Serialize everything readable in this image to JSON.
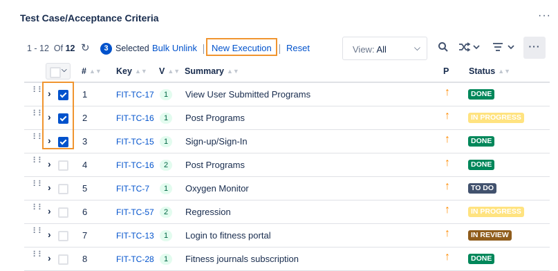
{
  "panel": {
    "title": "Test Case/Acceptance Criteria",
    "more_label": "···"
  },
  "toolbar": {
    "range": "1 - 12",
    "of_label": "Of",
    "total": "12",
    "refresh_icon": "refresh-icon",
    "selected_count": "3",
    "selected_label": "Selected",
    "bulk_unlink": "Bulk Unlink",
    "new_execution": "New Execution",
    "reset": "Reset",
    "view_label": "View:",
    "view_value": "All",
    "more_label": "···"
  },
  "columns": {
    "num": "#",
    "key": "Key",
    "version": "V",
    "summary": "Summary",
    "priority": "P",
    "status": "Status"
  },
  "colors": {
    "accent": "#0052cc",
    "highlight": "#f0942e",
    "done": "#00875a",
    "in_progress": "#ffe380",
    "todo": "#42526e",
    "in_review": "#8f5c1c",
    "priority": "#ff8b00"
  },
  "rows": [
    {
      "num": "1",
      "key": "FIT-TC-17",
      "version": "1",
      "summary": "View User Submitted Programs",
      "status": "DONE",
      "status_type": "done",
      "checked": true
    },
    {
      "num": "2",
      "key": "FIT-TC-16",
      "version": "1",
      "summary": "Post Programs",
      "status": "IN PROGRESS",
      "status_type": "progress",
      "checked": true
    },
    {
      "num": "3",
      "key": "FIT-TC-15",
      "version": "1",
      "summary": "Sign-up/Sign-In",
      "status": "DONE",
      "status_type": "done",
      "checked": true
    },
    {
      "num": "4",
      "key": "FIT-TC-16",
      "version": "2",
      "summary": "Post Programs",
      "status": "DONE",
      "status_type": "done",
      "checked": false
    },
    {
      "num": "5",
      "key": "FIT-TC-7",
      "version": "1",
      "summary": "Oxygen Monitor",
      "status": "TO DO",
      "status_type": "todo",
      "checked": false
    },
    {
      "num": "6",
      "key": "FIT-TC-57",
      "version": "2",
      "summary": "Regression",
      "status": "IN PROGRESS",
      "status_type": "progress",
      "checked": false
    },
    {
      "num": "7",
      "key": "FIT-TC-13",
      "version": "1",
      "summary": "Login to fitness portal",
      "status": "IN REVIEW",
      "status_type": "review",
      "checked": false
    },
    {
      "num": "8",
      "key": "FIT-TC-28",
      "version": "1",
      "summary": "Fitness journals subscription",
      "status": "DONE",
      "status_type": "done",
      "checked": false
    }
  ]
}
